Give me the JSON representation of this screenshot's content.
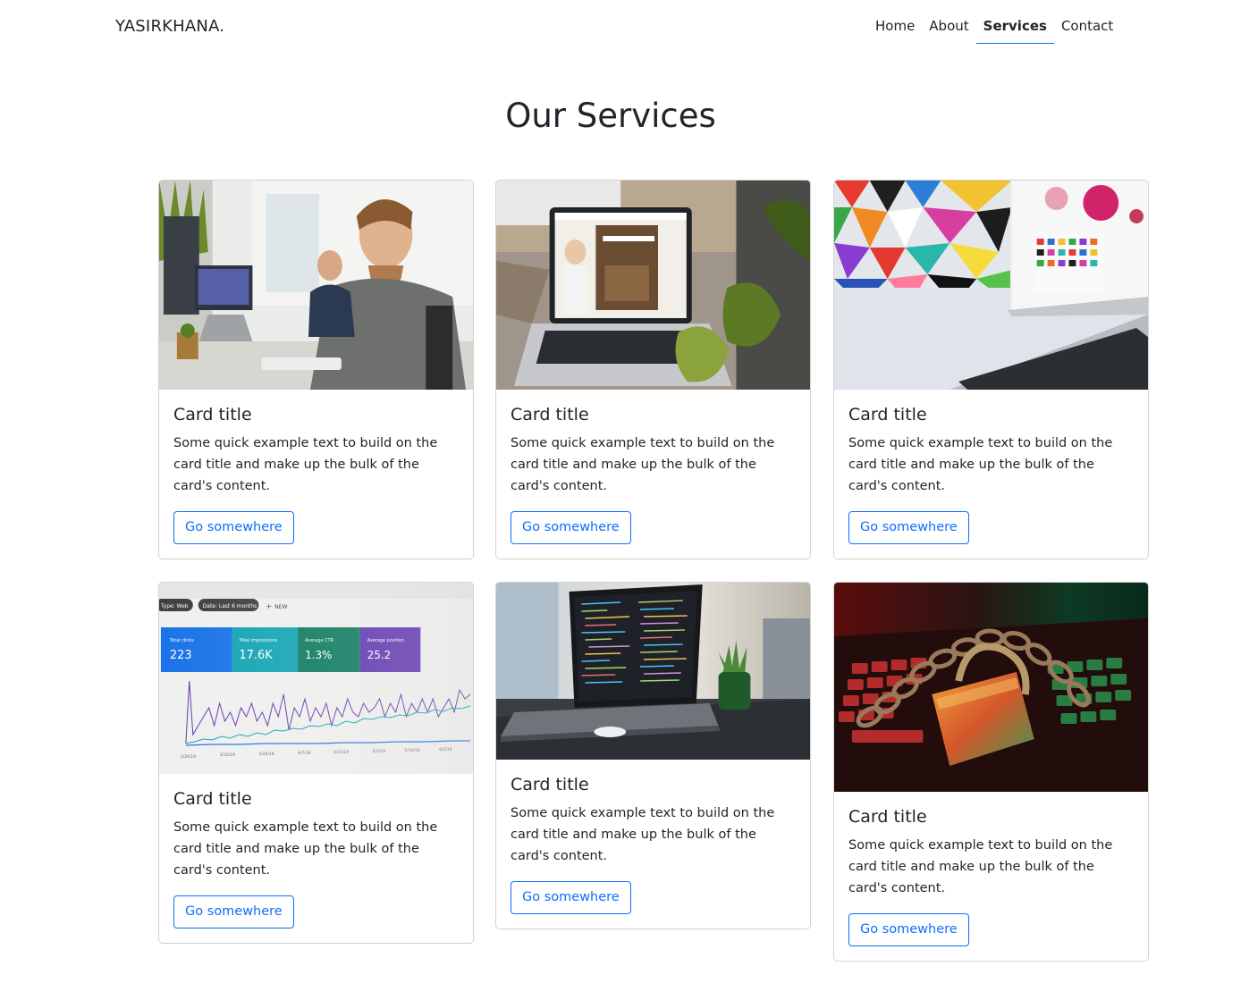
{
  "navbar": {
    "brand": "YASIRKHANA.",
    "links": [
      {
        "label": "Home"
      },
      {
        "label": "About"
      },
      {
        "label": "Services",
        "active": true
      },
      {
        "label": "Contact"
      }
    ],
    "accent_color": "#0d6efd"
  },
  "main": {
    "title": "Our Services",
    "cards": [
      {
        "title": "Card title",
        "text": "Some quick example text to build on the card title and make up the bulk of the card's content.",
        "button": "Go somewhere",
        "image": "developers-at-desk"
      },
      {
        "title": "Card title",
        "text": "Some quick example text to build on the card title and make up the bulk of the card's content.",
        "button": "Go somewhere",
        "image": "laptop-website"
      },
      {
        "title": "Card title",
        "text": "Some quick example text to build on the card title and make up the bulk of the card's content.",
        "button": "Go somewhere",
        "image": "laptop-colorful-design"
      },
      {
        "title": "Card title",
        "text": "Some quick example text to build on the card title and make up the bulk of the card's content.",
        "button": "Go somewhere",
        "image": "analytics-dashboard",
        "image_labels": {
          "filter_type": "Type: Web",
          "filter_date": "Date: Last 6 months",
          "new": "NEW",
          "metrics": [
            {
              "label": "Total clicks",
              "value": "223"
            },
            {
              "label": "Total impressions",
              "value": "17.6K"
            },
            {
              "label": "Average CTR",
              "value": "1.3%"
            },
            {
              "label": "Average position",
              "value": "25.2"
            }
          ],
          "dates": [
            "2/24/19",
            "3/10/19",
            "3/24/19",
            "4/7/19",
            "4/21/19",
            "5/5/19",
            "5/19/19",
            "6/2/19"
          ]
        }
      },
      {
        "title": "Card title",
        "text": "Some quick example text to build on the card title and make up the bulk of the card's content.",
        "button": "Go somewhere",
        "image": "laptop-code-editor"
      },
      {
        "title": "Card title",
        "text": "Some quick example text to build on the card title and make up the bulk of the card's content.",
        "button": "Go somewhere",
        "image": "padlock-chain-keyboard"
      }
    ]
  }
}
